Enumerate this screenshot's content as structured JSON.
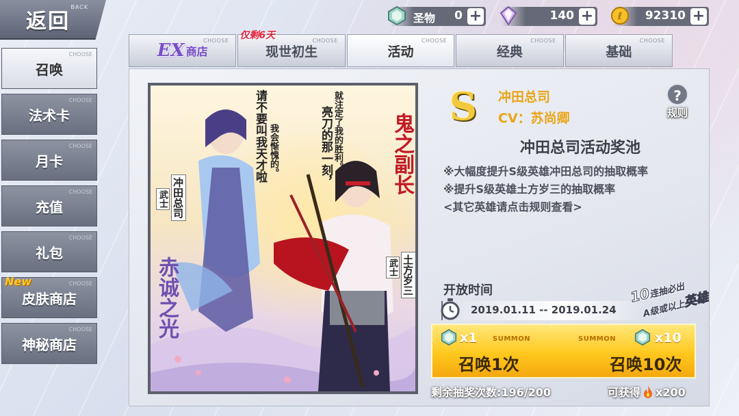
{
  "colors": {
    "accent_gold": "#e9a417",
    "button_gold": "#ffc81d",
    "limited_red": "#e0233c",
    "ex_purple": "#7a4ec8",
    "menu_gray": "#6a6f80"
  },
  "back_button": {
    "label": "返回",
    "sub": "BACK"
  },
  "resources": [
    {
      "name": "relic",
      "label": "圣物",
      "value": "0",
      "icon": "gem-relic-icon"
    },
    {
      "name": "crystal",
      "label": "",
      "value": "140",
      "icon": "crystal-icon"
    },
    {
      "name": "coin",
      "label": "",
      "value": "92310",
      "icon": "coin-icon"
    }
  ],
  "tabs": [
    {
      "id": "ex-shop",
      "label": "商店",
      "logo": "EX",
      "choose": "CHOOSE",
      "active": false
    },
    {
      "id": "current",
      "label": "现世初生",
      "choose": "CHOOSE",
      "limited": "仅剩6天",
      "active": false
    },
    {
      "id": "event",
      "label": "活动",
      "choose": "CHOOSE",
      "active": true
    },
    {
      "id": "classic",
      "label": "经典",
      "choose": "CHOOSE",
      "active": false
    },
    {
      "id": "basic",
      "label": "基础",
      "choose": "CHOOSE",
      "active": false
    }
  ],
  "sidebar": {
    "items": [
      {
        "id": "summon",
        "label": "召唤",
        "choose": "CHOOSE",
        "active": true
      },
      {
        "id": "spell-card",
        "label": "法术卡",
        "choose": "CHOOSE"
      },
      {
        "id": "monthly-card",
        "label": "月卡",
        "choose": "CHOOSE"
      },
      {
        "id": "recharge",
        "label": "充值",
        "choose": "CHOOSE"
      },
      {
        "id": "gift-pack",
        "label": "礼包",
        "choose": "CHOOSE"
      },
      {
        "id": "skin-shop",
        "label": "皮肤商店",
        "choose": "CHOOSE",
        "badge": "New"
      },
      {
        "id": "mystery-shop",
        "label": "神秘商店",
        "choose": "CHOOSE"
      }
    ]
  },
  "artwork": {
    "left_quote": "请不要叫我天才啦",
    "left_quote2": "我会惭愧的。",
    "right_quote": "就注定了我的胜利。",
    "right_quote2": "亮刀的那一刻，",
    "hero1_name": "冲田总司",
    "hero1_class": "武士",
    "hero1_title": "赤诚之光",
    "hero2_name": "土方岁三",
    "hero2_class": "武士",
    "hero2_title": "鬼之副长"
  },
  "hero": {
    "rank": "S",
    "name": "冲田总司",
    "cv": "CV：苏尚卿",
    "pool_title": "冲田总司活动奖池",
    "desc1": "※大幅度提升S级英雄冲田总司的抽取概率",
    "desc2": "※提升S级英雄土方岁三的抽取概率",
    "desc3": "<其它英雄请点击规则查看>"
  },
  "rules_label": "规则",
  "open_time": {
    "label": "开放时间",
    "range": "2019.01.11 -- 2019.01.24"
  },
  "promo": {
    "line1_num": "10",
    "line1": "连抽必出",
    "line2_a": "A级或以上",
    "line2_b": "英雄"
  },
  "summon_one": {
    "cost": "x1",
    "tag": "SUMMON",
    "label": "召唤1次"
  },
  "summon_ten": {
    "cost": "x10",
    "tag": "SUMMON",
    "label": "召唤10次"
  },
  "footer": {
    "remaining": "剩余抽奖次数:196/200",
    "obtain_label": "可获得",
    "obtain_value": "x200"
  }
}
